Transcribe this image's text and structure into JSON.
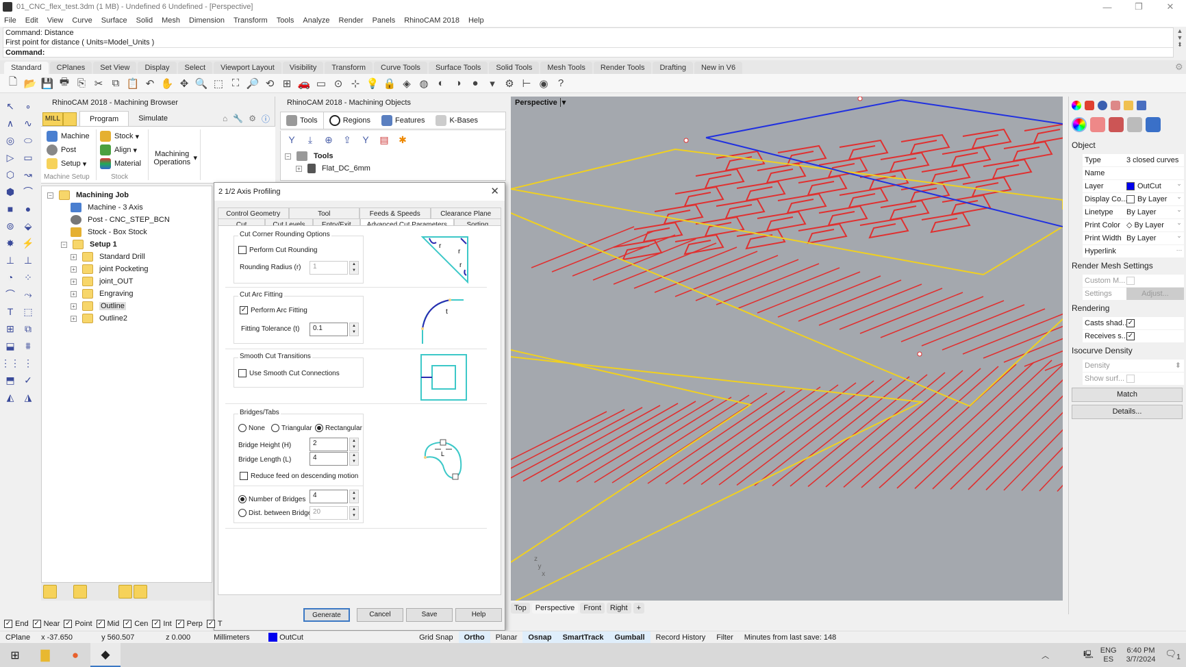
{
  "window": {
    "title": "01_CNC_flex_test.3dm (1 MB) - Undefined 6 Undefined - [Perspective]",
    "controls": {
      "minimize": "—",
      "restore": "❐",
      "close": "✕"
    }
  },
  "menu": [
    "File",
    "Edit",
    "View",
    "Curve",
    "Surface",
    "Solid",
    "Mesh",
    "Dimension",
    "Transform",
    "Tools",
    "Analyze",
    "Render",
    "Panels",
    "RhinoCAM 2018",
    "Help"
  ],
  "command": {
    "history": [
      "Command: Distance",
      "First point for distance ( Units=Model_Units )"
    ],
    "prompt": "Command:"
  },
  "toolbar_tabs": [
    {
      "label": "Standard",
      "active": true
    },
    {
      "label": "CPlanes"
    },
    {
      "label": "Set View"
    },
    {
      "label": "Display"
    },
    {
      "label": "Select"
    },
    {
      "label": "Viewport Layout"
    },
    {
      "label": "Visibility"
    },
    {
      "label": "Transform"
    },
    {
      "label": "Curve Tools"
    },
    {
      "label": "Surface Tools"
    },
    {
      "label": "Solid Tools"
    },
    {
      "label": "Mesh Tools"
    },
    {
      "label": "Render Tools"
    },
    {
      "label": "Drafting"
    },
    {
      "label": "New in V6"
    }
  ],
  "toolbar_icons": [
    {
      "name": "new-icon",
      "glyph": "🗋"
    },
    {
      "name": "open-icon",
      "glyph": "📂"
    },
    {
      "name": "save-icon",
      "glyph": "💾"
    },
    {
      "name": "print-icon",
      "glyph": "🖶"
    },
    {
      "name": "import-icon",
      "glyph": "⎘"
    },
    {
      "name": "cut-icon",
      "glyph": "✂"
    },
    {
      "name": "copy-icon",
      "glyph": "⧉"
    },
    {
      "name": "paste-icon",
      "glyph": "📋"
    },
    {
      "name": "undo-icon",
      "glyph": "↶"
    },
    {
      "name": "pan-icon",
      "glyph": "✋"
    },
    {
      "name": "rotate-view-icon",
      "glyph": "✥"
    },
    {
      "name": "zoom-icon",
      "glyph": "🔍"
    },
    {
      "name": "zoom-window-icon",
      "glyph": "⬚"
    },
    {
      "name": "zoom-extents-icon",
      "glyph": "⛶"
    },
    {
      "name": "zoom-selected-icon",
      "glyph": "🔎"
    },
    {
      "name": "undo-view-icon",
      "glyph": "⟲"
    },
    {
      "name": "four-viewports-icon",
      "glyph": "⊞"
    },
    {
      "name": "car-icon",
      "glyph": "🚗"
    },
    {
      "name": "blank-icon",
      "glyph": "▭"
    },
    {
      "name": "point-icon",
      "glyph": "⊙"
    },
    {
      "name": "snap-icon",
      "glyph": "⊹"
    },
    {
      "name": "light-icon",
      "glyph": "💡"
    },
    {
      "name": "lock-icon",
      "glyph": "🔒"
    },
    {
      "name": "layer-icon",
      "glyph": "◈"
    },
    {
      "name": "color-wheel-icon",
      "glyph": "◍"
    },
    {
      "name": "shaded-icon",
      "glyph": "◐"
    },
    {
      "name": "rendered-icon",
      "glyph": "◑"
    },
    {
      "name": "sphere-icon",
      "glyph": "●"
    },
    {
      "name": "funnel-icon",
      "glyph": "▾"
    },
    {
      "name": "gear-icon",
      "glyph": "⚙"
    },
    {
      "name": "dimension-icon",
      "glyph": "⊢"
    },
    {
      "name": "globe-icon",
      "glyph": "◉"
    },
    {
      "name": "help-icon",
      "glyph": "?"
    }
  ],
  "machining_browser": {
    "title": "RhinoCAM 2018 - Machining Browser",
    "mode": "MILL",
    "tabs": [
      {
        "label": "Program",
        "active": true
      },
      {
        "label": "Simulate"
      }
    ],
    "ribbon": {
      "machine_setup": {
        "buttons": [
          "Machine",
          "Post",
          "Setup"
        ],
        "label": "Machine Setup"
      },
      "stock": {
        "buttons": [
          "Stock",
          "Align",
          "Material"
        ],
        "label": "Stock"
      },
      "operations": {
        "label": "Machining Operations"
      }
    },
    "tree": {
      "root": "Machining Job",
      "items": [
        {
          "label": "Machine - 3 Axis"
        },
        {
          "label": "Post - CNC_STEP_BCN"
        },
        {
          "label": "Stock - Box Stock"
        }
      ],
      "setup": "Setup 1",
      "folders": [
        {
          "label": "Standard Drill"
        },
        {
          "label": "joint Pocketing"
        },
        {
          "label": "joint_OUT"
        },
        {
          "label": "Engraving"
        },
        {
          "label": "Outline",
          "selected": true
        },
        {
          "label": "Outline2"
        }
      ]
    }
  },
  "machining_objects": {
    "title": "RhinoCAM 2018 - Machining Objects",
    "tabs": [
      {
        "label": "Tools",
        "active": true
      },
      {
        "label": "Regions"
      },
      {
        "label": "Features"
      },
      {
        "label": "K-Bases"
      }
    ],
    "tree_root": "Tools",
    "tools": [
      "Flat_DC_6mm"
    ]
  },
  "dialog": {
    "title": "2 1/2 Axis Profiling",
    "close": "✕",
    "tabs_row1": [
      "Control Geometry",
      "Tool",
      "Feeds & Speeds",
      "Clearance Plane"
    ],
    "tabs_row2": [
      "Cut Parameters",
      "Cut Levels",
      "Entry/Exit",
      "Advanced Cut Parameters",
      "Sorting"
    ],
    "active_tab": "Advanced Cut Parameters",
    "corner_rounding": {
      "group": "Cut Corner Rounding Options",
      "checkbox": "Perform Cut Rounding",
      "checked": false,
      "radius_label": "Rounding Radius (r)",
      "radius_value": "1"
    },
    "arc_fitting": {
      "group": "Cut Arc Fitting",
      "checkbox": "Perform Arc Fitting",
      "checked": true,
      "tolerance_label": "Fitting Tolerance (t)",
      "tolerance_value": "0.1"
    },
    "smooth": {
      "group": "Smooth Cut Transitions",
      "checkbox": "Use Smooth Cut Connections",
      "checked": false
    },
    "bridges": {
      "group": "Bridges/Tabs",
      "types": [
        {
          "label": "None"
        },
        {
          "label": "Triangular"
        },
        {
          "label": "Rectangular",
          "selected": true
        }
      ],
      "height_label": "Bridge Height (H)",
      "height_value": "2",
      "length_label": "Bridge Length (L)",
      "length_value": "4",
      "reduce_feed": "Reduce feed on descending motion",
      "reduce_checked": false,
      "count_label": "Number of Bridges",
      "count_value": "4",
      "count_selected": true,
      "dist_label": "Dist. between Bridges",
      "dist_value": "20"
    },
    "illus_labels": {
      "r": "r",
      "t": "t",
      "L": "L"
    },
    "buttons": {
      "generate": "Generate",
      "cancel": "Cancel",
      "save": "Save",
      "help": "Help"
    }
  },
  "viewport": {
    "label": "Perspective",
    "tabs": [
      {
        "label": "Top"
      },
      {
        "label": "Perspective",
        "active": true
      },
      {
        "label": "Front"
      },
      {
        "label": "Right"
      }
    ],
    "add_tab": "+",
    "colors": {
      "bg": "#a4a8ae",
      "toolpath": "#e03030",
      "boundary": "#f0d020",
      "selected": "#2030e0"
    }
  },
  "properties": {
    "object_header": "Object",
    "rows": [
      {
        "key": "Type",
        "value": "3 closed curves"
      },
      {
        "key": "Name",
        "value": ""
      },
      {
        "key": "Layer",
        "value": "OutCut",
        "swatch": "#0000ee"
      },
      {
        "key": "Display Co...",
        "value": "By Layer",
        "swatch": "#ffffff"
      },
      {
        "key": "Linetype",
        "value": "By Layer"
      },
      {
        "key": "Print Color",
        "value": "◇ By Layer"
      },
      {
        "key": "Print Width",
        "value": "By Layer"
      },
      {
        "key": "Hyperlink",
        "value": ""
      }
    ],
    "render_mesh": {
      "header": "Render Mesh Settings",
      "custom": "Custom M...",
      "settings": "Settings",
      "adjust": "Adjust..."
    },
    "rendering": {
      "header": "Rendering",
      "casts": "Casts shad...",
      "receives": "Receives s..."
    },
    "isocurve": {
      "header": "Isocurve Density",
      "density": "Density",
      "show": "Show surf..."
    },
    "match": "Match",
    "details": "Details..."
  },
  "osnaps": [
    {
      "label": "End",
      "checked": true
    },
    {
      "label": "Near",
      "checked": true
    },
    {
      "label": "Point",
      "checked": true
    },
    {
      "label": "Mid",
      "checked": true
    },
    {
      "label": "Cen",
      "checked": true
    },
    {
      "label": "Int",
      "checked": true
    },
    {
      "label": "Perp",
      "checked": true
    },
    {
      "label": "T",
      "checked": true
    }
  ],
  "statusbar": {
    "cplane": "CPlane",
    "x": "x -37.650",
    "y": "y 560.507",
    "z": "z 0.000",
    "units": "Millimeters",
    "layer": "OutCut",
    "layer_color": "#0000ee",
    "toggles": [
      {
        "label": "Grid Snap",
        "on": false
      },
      {
        "label": "Ortho",
        "on": true
      },
      {
        "label": "Planar",
        "on": false
      },
      {
        "label": "Osnap",
        "on": true
      },
      {
        "label": "SmartTrack",
        "on": true
      },
      {
        "label": "Gumball",
        "on": true
      },
      {
        "label": "Record History",
        "on": false
      },
      {
        "label": "Filter",
        "on": false
      }
    ],
    "save_info": "Minutes from last save: 148"
  },
  "taskbar": {
    "apps": [
      {
        "name": "windows-start"
      },
      {
        "name": "file-explorer"
      },
      {
        "name": "firefox"
      },
      {
        "name": "rhino",
        "active": true
      }
    ],
    "lang1": "ENG",
    "lang2": "ES",
    "time": "6:40 PM",
    "date": "3/7/2024",
    "notifications": "1"
  }
}
